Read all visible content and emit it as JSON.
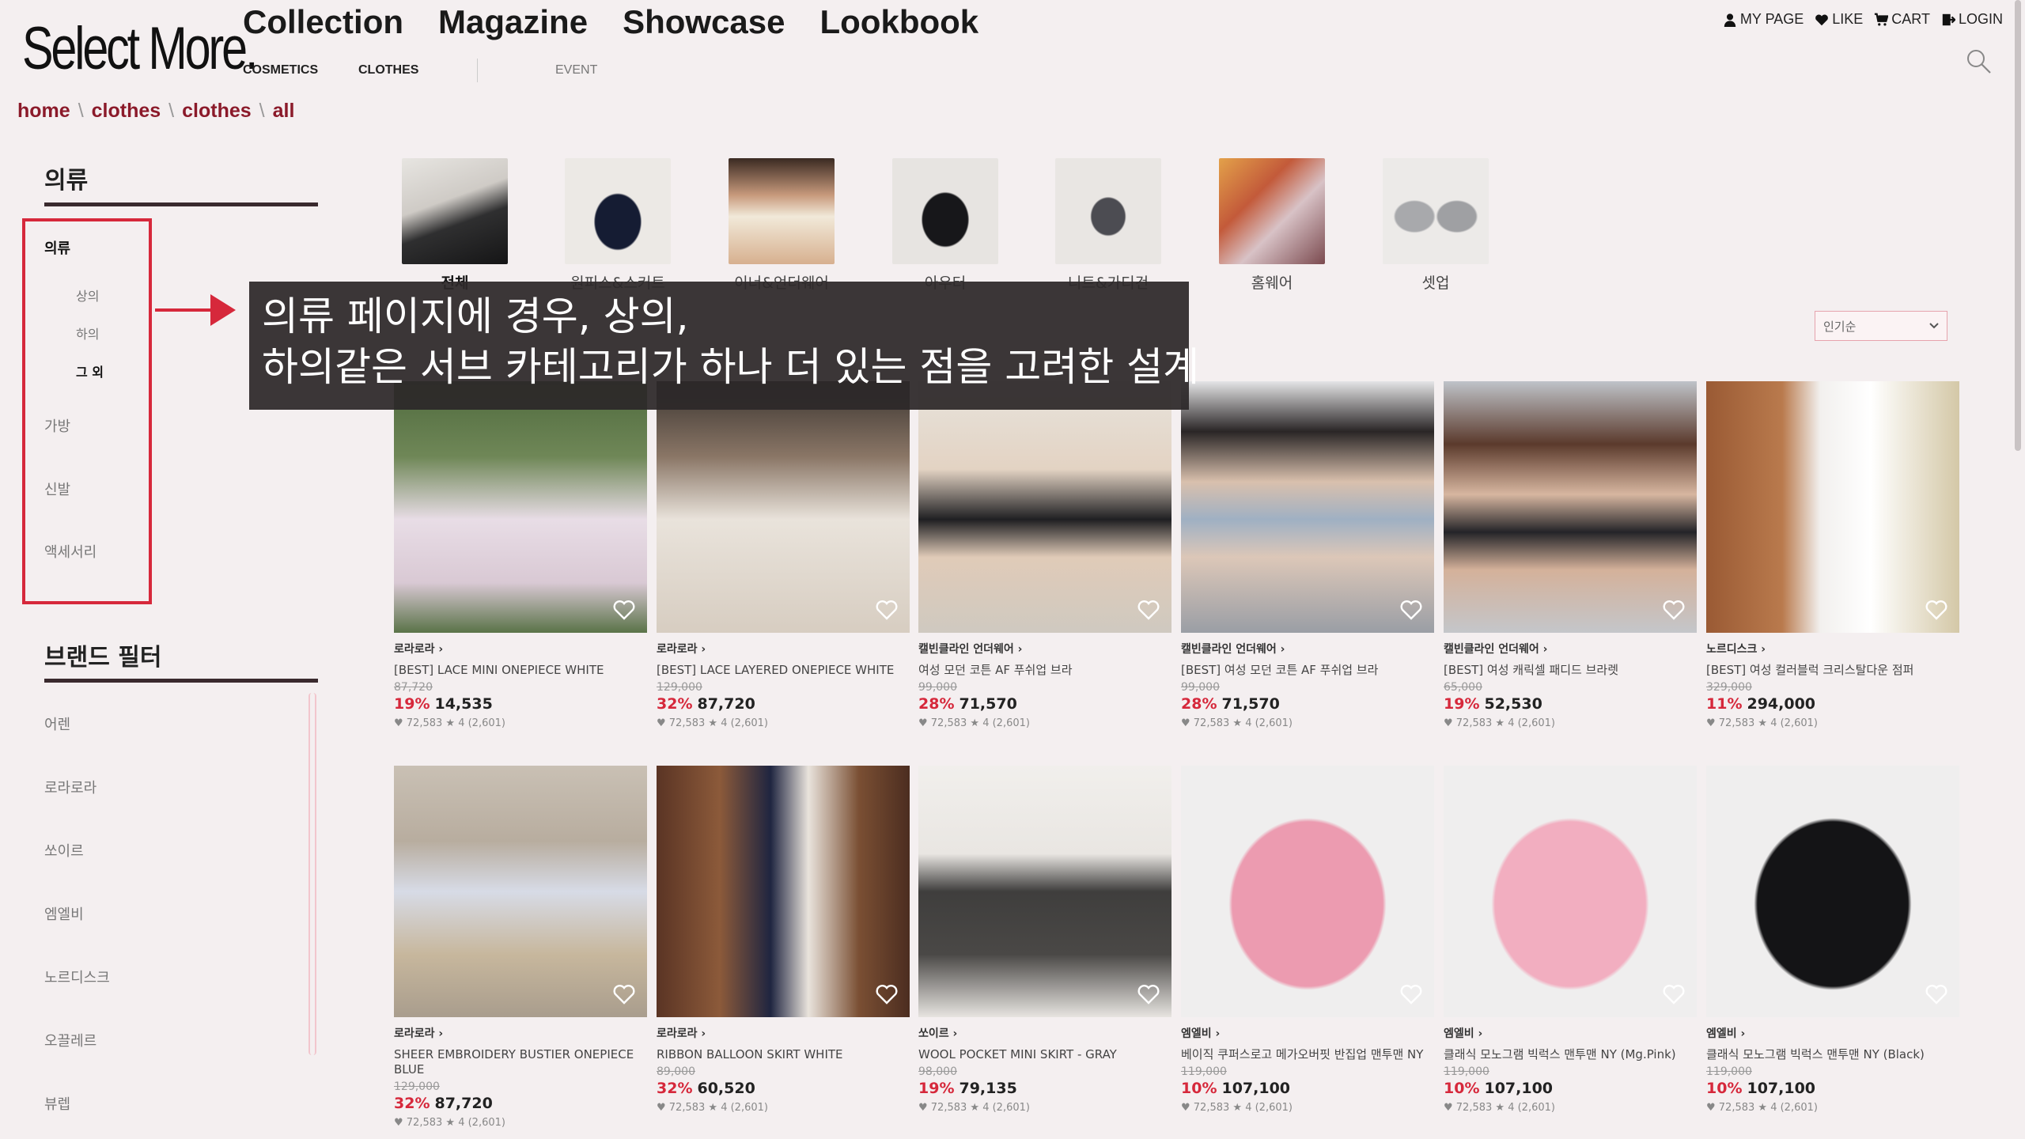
{
  "logo": "Select More.",
  "nav": {
    "main": [
      "Collection",
      "Magazine",
      "Showcase",
      "Lookbook"
    ],
    "sub": [
      "COSMETICS",
      "CLOTHES",
      "EVENT"
    ]
  },
  "usermenu": {
    "mypage": "MY PAGE",
    "like": "LIKE",
    "cart": "CART",
    "login": "LOGIN"
  },
  "breadcrumb": [
    "home",
    "clothes",
    "clothes",
    "all"
  ],
  "breadcrumb_sep": "\\",
  "sidebar": {
    "category_title": "의류",
    "items": {
      "main": "의류",
      "sub1": "상의",
      "sub2": "하의",
      "sub3": "그 외",
      "bag": "가방",
      "shoes": "신발",
      "acc": "액세서리"
    },
    "brand_title": "브랜드 필터",
    "brands": [
      "어렌",
      "로라로라",
      "쏘이르",
      "엠엘비",
      "노르디스크",
      "오끌레르",
      "뷰렙"
    ]
  },
  "categories": [
    "전체",
    "원피스&스커트",
    "이너&언더웨어",
    "아우터",
    "니트&가디건",
    "홈웨어",
    "셋업"
  ],
  "annotation": {
    "line1": "의류 페이지에 경우, 상의,",
    "line2": "하의같은 서브 카테고리가 하나 더 있는 점을 고려한 설계"
  },
  "sort": {
    "selected": "인기순"
  },
  "products": [
    {
      "brand": "로라로라 ›",
      "name": "[BEST] LACE MINI ONEPIECE WHITE",
      "orig": "87,720",
      "disc": "19%",
      "price": "14,535",
      "stats": "♥ 72,583 ★ 4 (2,601)"
    },
    {
      "brand": "로라로라 ›",
      "name": "[BEST] LACE LAYERED ONEPIECE WHITE",
      "orig": "129,000",
      "disc": "32%",
      "price": "87,720",
      "stats": "♥ 72,583 ★ 4 (2,601)"
    },
    {
      "brand": "캘빈클라인 언더웨어 ›",
      "name": "여성 모던 코튼 AF 푸쉬업 브라",
      "orig": "99,000",
      "disc": "28%",
      "price": "71,570",
      "stats": "♥ 72,583 ★ 4 (2,601)"
    },
    {
      "brand": "캘빈클라인 언더웨어 ›",
      "name": "[BEST] 여성 모던 코튼 AF 푸쉬업 브라",
      "orig": "99,000",
      "disc": "28%",
      "price": "71,570",
      "stats": "♥ 72,583 ★ 4 (2,601)"
    },
    {
      "brand": "캘빈클라인 언더웨어 ›",
      "name": "[BEST] 여성 캐릭셀 패디드 브라렛",
      "orig": "65,000",
      "disc": "19%",
      "price": "52,530",
      "stats": "♥ 72,583 ★ 4 (2,601)"
    },
    {
      "brand": "노르디스크 ›",
      "name": "[BEST] 여성 컬러블럭 크리스탈다운 점퍼",
      "orig": "329,000",
      "disc": "11%",
      "price": "294,000",
      "stats": "♥ 72,583 ★ 4 (2,601)"
    },
    {
      "brand": "로라로라 ›",
      "name": "SHEER EMBROIDERY BUSTIER ONEPIECE BLUE",
      "orig": "129,000",
      "disc": "32%",
      "price": "87,720",
      "stats": "♥ 72,583 ★ 4 (2,601)"
    },
    {
      "brand": "로라로라 ›",
      "name": "RIBBON BALLOON SKIRT WHITE",
      "orig": "89,000",
      "disc": "32%",
      "price": "60,520",
      "stats": "♥ 72,583 ★ 4 (2,601)"
    },
    {
      "brand": "쏘이르 ›",
      "name": "WOOL POCKET MINI SKIRT - GRAY",
      "orig": "98,000",
      "disc": "19%",
      "price": "79,135",
      "stats": "♥ 72,583 ★ 4 (2,601)"
    },
    {
      "brand": "엠엘비 ›",
      "name": "베이직 쿠퍼스로고 메가오버핏 반집업 맨투맨 NY",
      "orig": "119,000",
      "disc": "10%",
      "price": "107,100",
      "stats": "♥ 72,583 ★ 4 (2,601)"
    },
    {
      "brand": "엠엘비 ›",
      "name": "클래식 모노그램 빅럭스 맨투맨 NY (Mg.Pink)",
      "orig": "119,000",
      "disc": "10%",
      "price": "107,100",
      "stats": "♥ 72,583 ★ 4 (2,601)"
    },
    {
      "brand": "엠엘비 ›",
      "name": "클래식 모노그램 빅럭스 맨투맨 NY (Black)",
      "orig": "119,000",
      "disc": "10%",
      "price": "107,100",
      "stats": "♥ 72,583 ★ 4 (2,601)"
    }
  ],
  "colors": {
    "accent": "#d6283b",
    "breadcrumb": "#8b1a2a",
    "background": "#f4eff0"
  },
  "icons": {
    "heart": "heart-outline-icon",
    "search": "search-icon"
  }
}
